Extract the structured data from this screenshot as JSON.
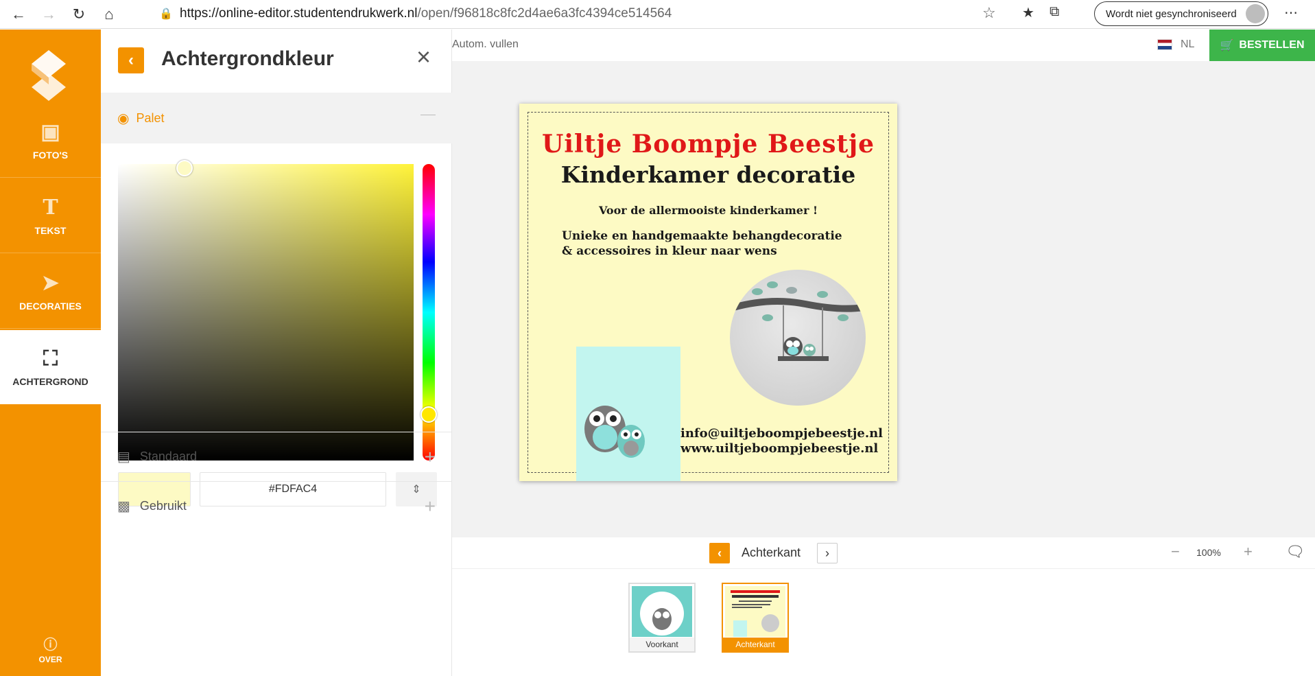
{
  "browser": {
    "url_host": "https://online-editor.studentendrukwerk.nl",
    "url_path": "/open/f96818c8fc2d4ae6a3fc4394ce514564",
    "sync_label": "Wordt niet gesynchroniseerd"
  },
  "sidebar": {
    "items": [
      {
        "label": "FOTO'S",
        "icon": "photos-icon"
      },
      {
        "label": "TEKST",
        "icon": "text-icon"
      },
      {
        "label": "DECORATIES",
        "icon": "origami-bird-icon"
      },
      {
        "label": "ACHTERGROND",
        "icon": "background-icon"
      }
    ],
    "over_label": "OVER"
  },
  "panel": {
    "title": "Achtergrondkleur",
    "palet_label": "Palet",
    "hex_value": "#FDFAC4",
    "standaard_label": "Standaard",
    "gebruikt_label": "Gebruikt"
  },
  "colors": {
    "accent": "#f39200",
    "order": "#3db54a",
    "background_color": "#fdfac4"
  },
  "toolbar": {
    "autofill_label": "Autom. vullen",
    "language": "NL",
    "order_label": "BESTELLEN"
  },
  "card": {
    "title": "Uiltje Boompje Beestje",
    "subtitle": "Kinderkamer decoratie",
    "tagline": "Voor de allermooiste kinderkamer !",
    "para_line1": "Unieke en handgemaakte behangdecoratie",
    "para_line2": "& accessoires in kleur naar wens",
    "email": "info@uiltjeboompjebeestje.nl",
    "website": "www.uiltjeboompjebeestje.nl"
  },
  "pager": {
    "current": "Achterkant",
    "zoom": "100%"
  },
  "thumbnails": [
    {
      "label": "Voorkant",
      "active": false
    },
    {
      "label": "Achterkant",
      "active": true
    }
  ]
}
